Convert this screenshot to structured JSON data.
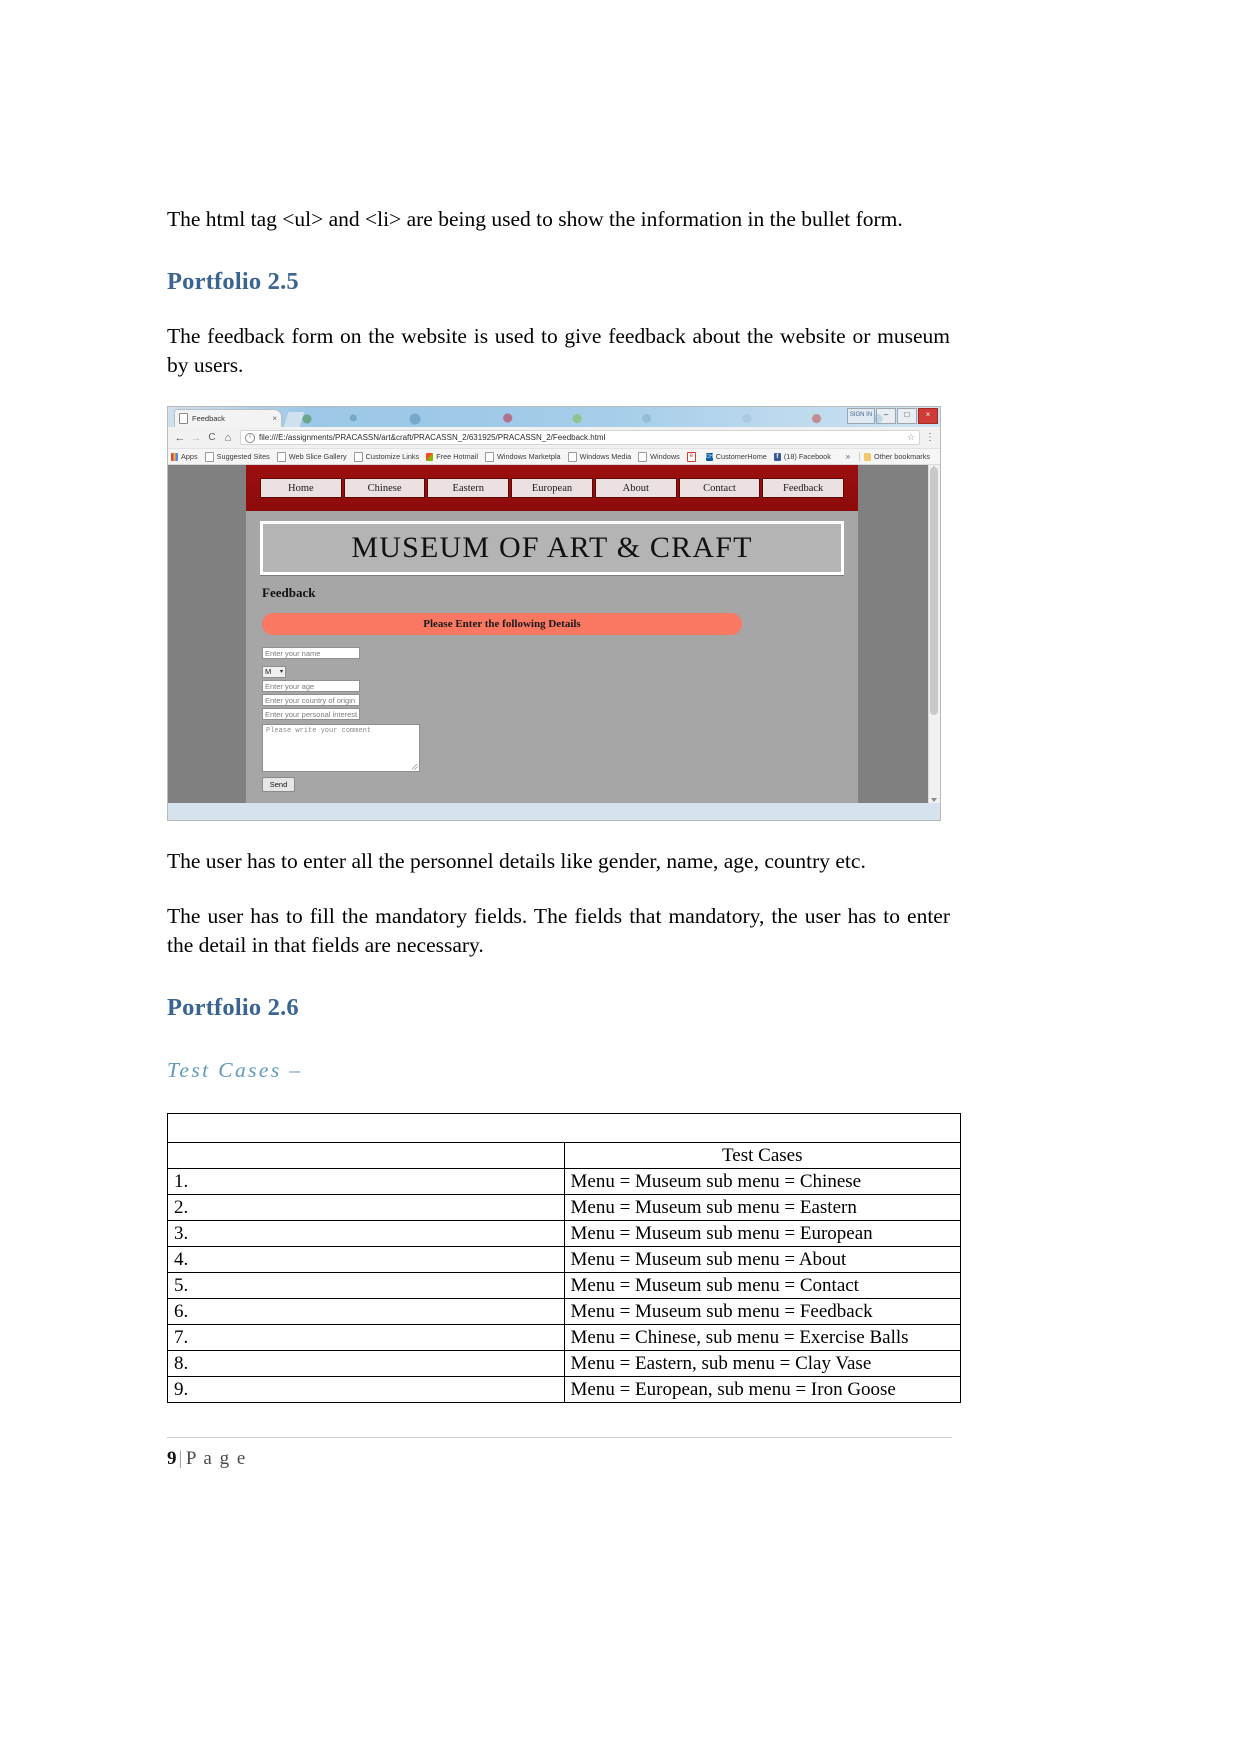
{
  "document": {
    "intro_paragraph": "The html tag <ul> and <li> are being used to show the information in the bullet form.",
    "portfolio_25_heading": "Portfolio 2.5",
    "feedback_paragraph": "The feedback form on the website is used to give feedback about the website or museum by users.",
    "personnel_paragraph": "The user has to enter all the personnel details like gender, name, age, country etc.",
    "mandatory_paragraph": "The user has to fill the mandatory fields. The fields that mandatory, the user has to enter the detail in that fields are necessary.",
    "portfolio_26_heading": "Portfolio 2.6",
    "test_cases_heading": "Test Cases –"
  },
  "browser": {
    "tab": {
      "title": "Feedback",
      "close_label": "×",
      "favicon": "page-icon"
    },
    "window_controls": {
      "restore_hint": "SIGN IN",
      "minimize": "–",
      "maximize": "□",
      "close": "×"
    },
    "toolbar": {
      "back": "←",
      "forward": "→",
      "reload": "C",
      "home": "⌂",
      "url": "file:///E:/assignments/PRACASSN/art&craft/PRACASSN_2/631925/PRACASSN_2/Feedback.html",
      "url_info_icon": "ⓘ",
      "bookmark_star": "☆",
      "menu": "⋮"
    },
    "bookmarks": [
      {
        "label": "Apps",
        "icon": "apps-grid-icon"
      },
      {
        "label": "Suggested Sites",
        "icon": "page-icon"
      },
      {
        "label": "Web Slice Gallery",
        "icon": "page-icon"
      },
      {
        "label": "Customize Links",
        "icon": "page-icon"
      },
      {
        "label": "Free Hotmail",
        "icon": "microsoft-icon"
      },
      {
        "label": "Windows Marketpla",
        "icon": "page-icon"
      },
      {
        "label": "Windows Media",
        "icon": "page-icon"
      },
      {
        "label": "Windows",
        "icon": "page-icon"
      },
      {
        "label": "",
        "icon": "ie-icon"
      },
      {
        "label": "CustomerHome",
        "icon": "customer-icon"
      },
      {
        "label": "(18) Facebook",
        "icon": "facebook-icon"
      }
    ],
    "bookmarks_overflow": "»",
    "other_bookmarks": "Other bookmarks"
  },
  "website": {
    "nav": [
      "Home",
      "Chinese",
      "Eastern",
      "European",
      "About",
      "Contact",
      "Feedback"
    ],
    "banner_title": "MUSEUM OF ART & CRAFT",
    "section_label": "Feedback",
    "please_bar": "Please Enter the following Details",
    "fields": [
      {
        "name": "name-field",
        "placeholder": "Enter your name"
      },
      {
        "name": "country-field",
        "placeholder": "Enter your country of origin"
      },
      {
        "name": "interest-field",
        "placeholder": "Enter your personal interest"
      },
      {
        "name": "age-field",
        "placeholder": "Enter your age"
      }
    ],
    "gender_select": {
      "value": "M",
      "caret": "▾"
    },
    "comment_placeholder": "Please write your comment",
    "send_button": "Send",
    "colors": {
      "nav_bar": "#8d0b0c",
      "page_bg": "#a6a6a6",
      "banner_highlight": "#fa7862"
    }
  },
  "table": {
    "title": "Test Cases",
    "rows": [
      {
        "num": "1.",
        "text": "Menu = Museum sub menu = Chinese"
      },
      {
        "num": "2.",
        "text": "Menu = Museum sub menu = Eastern"
      },
      {
        "num": "3.",
        "text": "Menu = Museum sub menu = European"
      },
      {
        "num": "4.",
        "text": "Menu = Museum sub menu = About"
      },
      {
        "num": "5.",
        "text": "Menu = Museum sub menu = Contact"
      },
      {
        "num": "6.",
        "text": "Menu = Museum sub menu = Feedback"
      },
      {
        "num": "7.",
        "text": "Menu = Chinese, sub menu = Exercise Balls"
      },
      {
        "num": "8.",
        "text": "Menu = Eastern, sub menu = Clay Vase"
      },
      {
        "num": "9.",
        "text": "Menu = European, sub menu = Iron Goose"
      }
    ]
  },
  "footer": {
    "page_number": "9",
    "separator": "|",
    "page_word": "P a g e"
  }
}
